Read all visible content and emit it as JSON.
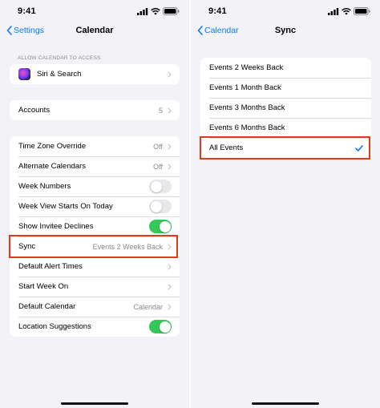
{
  "status": {
    "time": "9:41"
  },
  "left": {
    "nav": {
      "back_label": "Settings",
      "title": "Calendar"
    },
    "section_header": "ALLOW CALENDAR TO ACCESS",
    "siri_label": "Siri & Search",
    "accounts": {
      "label": "Accounts",
      "value": "5"
    },
    "settings": [
      {
        "label": "Time Zone Override",
        "value": "Off"
      },
      {
        "label": "Alternate Calendars",
        "value": "Off"
      },
      {
        "label": "Week Numbers",
        "toggle": false
      },
      {
        "label": "Week View Starts On Today",
        "toggle": false
      },
      {
        "label": "Show Invitee Declines",
        "toggle": true
      },
      {
        "label": "Sync",
        "value": "Events 2 Weeks Back",
        "highlighted": true
      },
      {
        "label": "Default Alert Times",
        "value": ""
      },
      {
        "label": "Start Week On",
        "value": ""
      },
      {
        "label": "Default Calendar",
        "value": "Calendar"
      },
      {
        "label": "Location Suggestions",
        "toggle": true
      }
    ]
  },
  "right": {
    "nav": {
      "back_label": "Calendar",
      "title": "Sync"
    },
    "options": [
      {
        "label": "Events 2 Weeks Back",
        "selected": false
      },
      {
        "label": "Events 1 Month Back",
        "selected": false
      },
      {
        "label": "Events 3 Months Back",
        "selected": false
      },
      {
        "label": "Events 6 Months Back",
        "selected": false
      },
      {
        "label": "All Events",
        "selected": true
      }
    ]
  },
  "colors": {
    "accent": "#0a7aff",
    "toggle_on": "#34c759",
    "highlight": "#e03a1e",
    "background": "#f2f2f7"
  }
}
